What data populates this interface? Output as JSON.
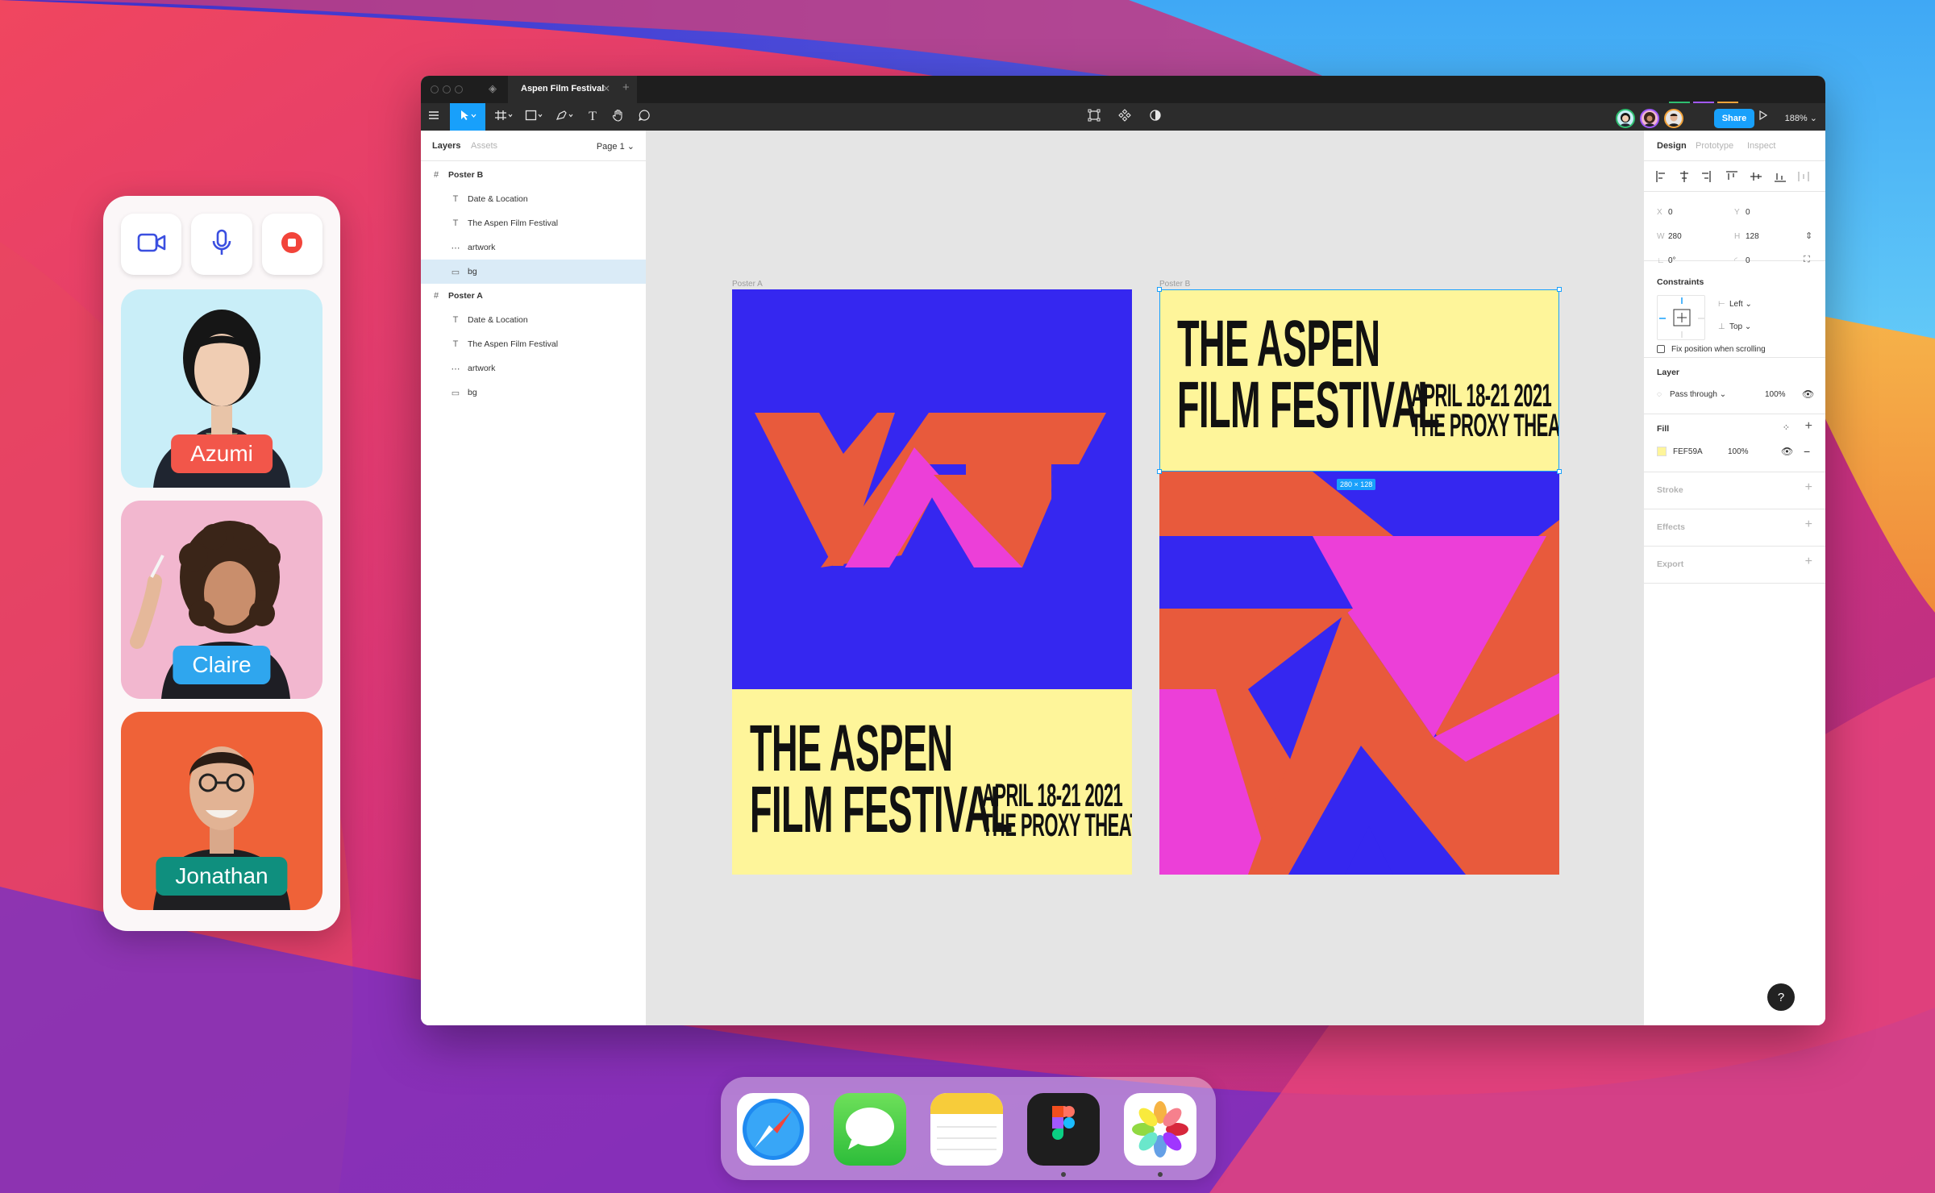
{
  "call": {
    "participants": [
      {
        "name": "Azumi",
        "tag_color": "#f2564a",
        "bg": "#c9eef8"
      },
      {
        "name": "Claire",
        "tag_color": "#2fa6ee",
        "bg": "#f2b7cf"
      },
      {
        "name": "Jonathan",
        "tag_color": "#0f8f7e",
        "bg": "#ef6238"
      }
    ],
    "controls": [
      "video-camera-icon",
      "microphone-icon",
      "record-icon"
    ]
  },
  "figma": {
    "tab_title": "Aspen Film Festival",
    "toolbar": {
      "share_label": "Share",
      "zoom": "188%"
    },
    "layers_panel": {
      "tabs": [
        "Layers",
        "Assets"
      ],
      "page": "Page 1",
      "items": [
        {
          "name": "Poster B",
          "type": "frame",
          "level": 0,
          "selected": false
        },
        {
          "name": "Date & Location",
          "type": "text",
          "level": 1,
          "selected": false
        },
        {
          "name": "The Aspen Film Festival",
          "type": "text",
          "level": 1,
          "selected": false
        },
        {
          "name": "artwork",
          "type": "group",
          "level": 1,
          "selected": false
        },
        {
          "name": "bg",
          "type": "rect",
          "level": 1,
          "selected": true
        },
        {
          "name": "Poster A",
          "type": "frame",
          "level": 0,
          "selected": false
        },
        {
          "name": "Date & Location",
          "type": "text",
          "level": 1,
          "selected": false
        },
        {
          "name": "The Aspen Film Festival",
          "type": "text",
          "level": 1,
          "selected": false
        },
        {
          "name": "artwork",
          "type": "group",
          "level": 1,
          "selected": false
        },
        {
          "name": "bg",
          "type": "rect",
          "level": 1,
          "selected": false
        }
      ]
    },
    "canvas": {
      "poster_a_label": "Poster A",
      "poster_b_label": "Poster B",
      "title_line1": "THE ASPEN",
      "title_line2": "FILM FESTIVAL",
      "date_line1": "APRIL 18-21 2021",
      "date_line2": "THE PROXY THEATRE",
      "selection_size": "280 × 128",
      "colors": {
        "blue": "#3527f0",
        "orange": "#e85a3c",
        "pink": "#ec3fd8",
        "cream": "#fef59a"
      }
    },
    "design_panel": {
      "tabs": [
        "Design",
        "Prototype",
        "Inspect"
      ],
      "x_label": "X",
      "x": "0",
      "y_label": "Y",
      "y": "0",
      "w_label": "W",
      "w": "280",
      "h_label": "H",
      "h": "128",
      "rotation": "0°",
      "radius": "0",
      "constraints_title": "Constraints",
      "constraint_h": "Left",
      "constraint_v": "Top",
      "fix_position": "Fix position when scrolling",
      "layer_title": "Layer",
      "blend_mode": "Pass through",
      "layer_opacity": "100%",
      "fill_title": "Fill",
      "fill_hex": "FEF59A",
      "fill_opacity": "100%",
      "stroke_title": "Stroke",
      "effects_title": "Effects",
      "export_title": "Export"
    },
    "help": "?"
  },
  "dock": {
    "apps": [
      "safari-icon",
      "messages-icon",
      "notes-icon",
      "figma-icon",
      "photos-icon"
    ]
  }
}
